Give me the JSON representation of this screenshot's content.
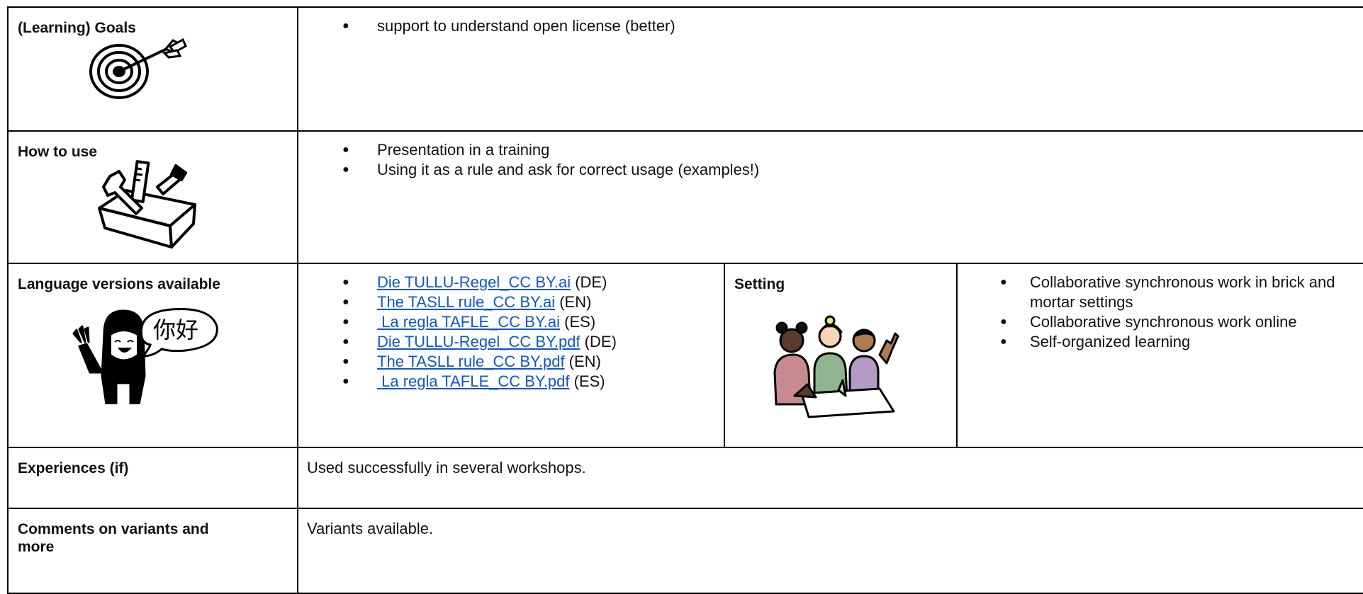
{
  "rows": {
    "goals": {
      "label": "(Learning) Goals",
      "icon": "target-arrow-icon",
      "items": [
        "support to understand open license (better)"
      ]
    },
    "how_to_use": {
      "label": "How to use",
      "icon": "toolbox-icon",
      "items": [
        "Presentation in a training",
        "Using it as a rule and ask for correct usage (examples!)"
      ]
    },
    "languages": {
      "label": "Language versions available",
      "icon": "waving-person-nihao-icon",
      "speech_text": "你好",
      "links": [
        {
          "text": "Die TULLU-Regel_CC BY.ai",
          "suffix": " (DE)"
        },
        {
          "text": "The TASLL rule_CC BY.ai",
          "suffix": " (EN)"
        },
        {
          "text": " La regla TAFLE_CC BY.ai",
          "suffix": " (ES)"
        },
        {
          "text": "Die TULLU-Regel_CC BY.pdf",
          "suffix": " (DE)"
        },
        {
          "text": "The TASLL rule_CC BY.pdf",
          "suffix": " (EN)"
        },
        {
          "text": " La regla TAFLE_CC BY.pdf",
          "suffix": " (ES)"
        }
      ]
    },
    "setting": {
      "label": "Setting",
      "icon": "group-collaboration-icon",
      "items": [
        "Collaborative synchronous work in brick and mortar settings",
        "Collaborative synchronous work online",
        "Self-organized learning"
      ]
    },
    "experiences": {
      "label": "Experiences (if)",
      "text": "Used successfully in several workshops."
    },
    "comments": {
      "label": "Comments on variants and more",
      "text": "Variants available."
    }
  },
  "colors": {
    "border": "#000000",
    "link": "#1155cc",
    "text": "#111111",
    "setting_people": [
      "#c98a8f",
      "#8fb48e",
      "#b49ac4"
    ]
  }
}
